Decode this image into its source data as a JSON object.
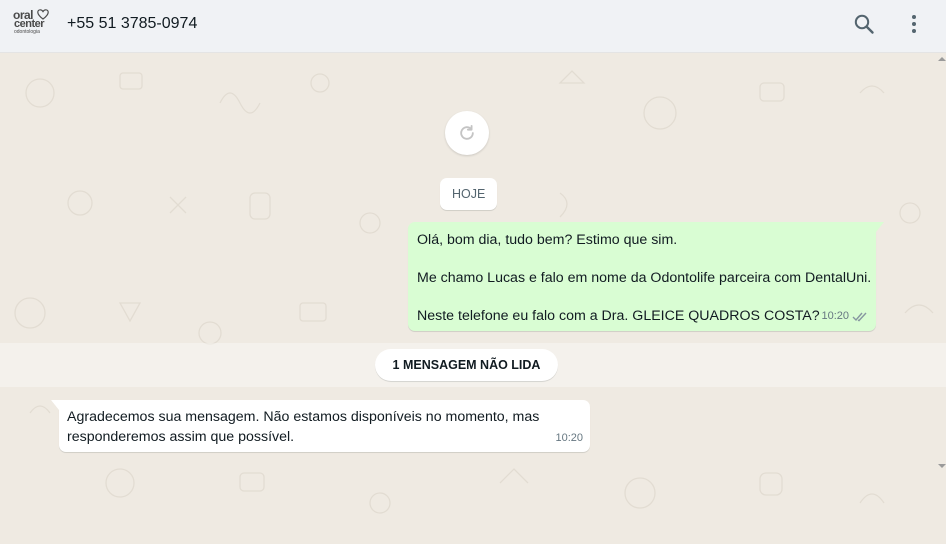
{
  "header": {
    "logo": {
      "line1": "oral",
      "line2": "center",
      "line3": "odontologia"
    },
    "title": "+55 51 3785-0974",
    "search_icon": "search-icon",
    "menu_icon": "kebab-menu-icon"
  },
  "chat": {
    "refresh_icon": "refresh-icon",
    "date_label": "HOJE",
    "outgoing": {
      "lines": [
        "Olá, bom dia, tudo bem? Estimo que sim.",
        "Me chamo Lucas e falo em nome da Odontolife parceira com DentalUni.",
        "Neste telefone eu falo com a Dra. GLEICE QUADROS COSTA?"
      ],
      "time": "10:20",
      "status_icon": "double-check-icon"
    },
    "unread_label": "1 MENSAGEM NÃO LIDA",
    "incoming": {
      "text": "Agradecemos sua mensagem. Não estamos disponíveis no momento, mas responderemos assim que possível.",
      "time": "10:20"
    }
  },
  "colors": {
    "outgoing_bubble": "#d9fdd3",
    "incoming_bubble": "#ffffff",
    "chat_background": "#efeae2",
    "header_background": "#f0f2f5"
  }
}
